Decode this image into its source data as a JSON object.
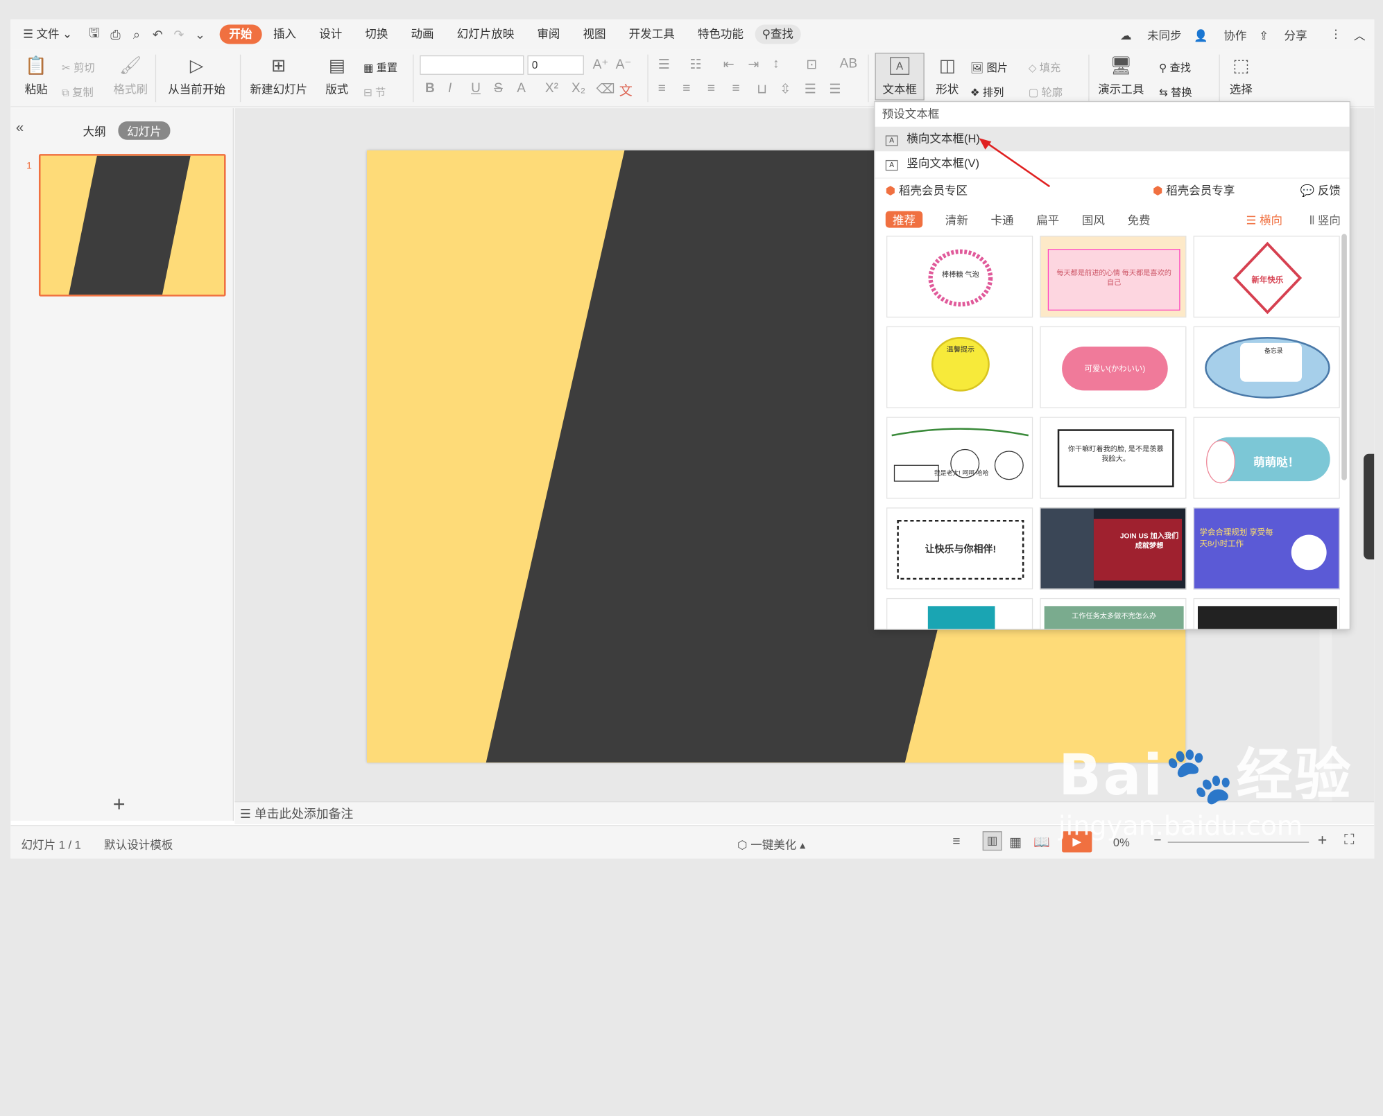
{
  "menu": {
    "file": "文件",
    "tabs": [
      "开始",
      "插入",
      "设计",
      "切换",
      "动画",
      "幻灯片放映",
      "审阅",
      "视图",
      "开发工具",
      "特色功能"
    ],
    "search": "查找",
    "right": {
      "sync": "未同步",
      "collab": "协作",
      "share": "分享"
    }
  },
  "ribbon": {
    "paste": "粘贴",
    "cut": "剪切",
    "copy": "复制",
    "format_painter": "格式刷",
    "play_from_current": "从当前开始",
    "new_slide": "新建幻灯片",
    "layout": "版式",
    "reset": "重置",
    "section": "节",
    "font_size": "0",
    "textbox": "文本框",
    "shape": "形状",
    "picture": "图片",
    "fill": "填充",
    "arrange": "排列",
    "outline": "轮廓",
    "presentation_tools": "演示工具",
    "find": "查找",
    "replace": "替换",
    "select": "选择"
  },
  "left_panel": {
    "outline_tab": "大纲",
    "slides_tab": "幻灯片",
    "slide_number": "1"
  },
  "notes_placeholder": "单击此处添加备注",
  "status": {
    "slide_indicator": "幻灯片 1 / 1",
    "template": "默认设计模板",
    "beautify": "一键美化",
    "zoom": "0%"
  },
  "dropdown": {
    "preset_header": "预设文本框",
    "horizontal": "横向文本框(H)",
    "vertical": "竖向文本框(V)",
    "member_zone": "稻壳会员专区",
    "member_exclusive": "稻壳会员专享",
    "feedback": "反馈",
    "categories": [
      "推荐",
      "清新",
      "卡通",
      "扁平",
      "国风",
      "免费"
    ],
    "orient_h": "横向",
    "orient_v": "竖向",
    "tiles": [
      {
        "text": "棒棒糖 气泡"
      },
      {
        "text": "每天都是前进的心情 每天都是喜欢的自己"
      },
      {
        "text": "新年快乐"
      },
      {
        "text": "温馨提示"
      },
      {
        "text": "可爱い(かわいい)"
      },
      {
        "text": "备忘录"
      },
      {
        "text": "我是老大! 呵呵 哈哈"
      },
      {
        "text": "你干嘛盯着我的脸, 是不是羡慕我脸大。"
      },
      {
        "text": "萌萌哒！"
      },
      {
        "text": "让快乐与你相伴!"
      },
      {
        "text": "JOIN US 加入我们 成就梦想"
      },
      {
        "text": "学会合理规划 享受每天8小时工作"
      },
      {
        "text": ""
      },
      {
        "text": "工作任务太多做不完怎么办"
      },
      {
        "text": ""
      }
    ]
  },
  "watermark": {
    "brand": "Bai",
    "brand2": "经验",
    "url": "jingyan.baidu.com"
  },
  "colors": {
    "accent": "#f07040",
    "slide_yellow": "#fedb78",
    "slide_dark": "#3d3d3d"
  }
}
